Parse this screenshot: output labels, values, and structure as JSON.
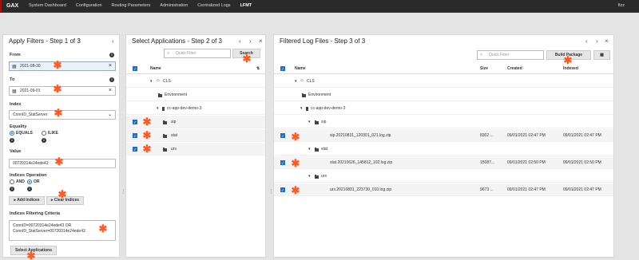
{
  "topbar": {
    "brand": "GAX",
    "nav": [
      "System Dashboard",
      "Configuration",
      "Routing Parameters",
      "Administration",
      "Centralized Logs",
      "LFMT"
    ],
    "active": "LFMT",
    "user": "fizz"
  },
  "filters": {
    "title": "Apply Filters - Step 1 of 3",
    "from_label": "From",
    "from_value": "2021-08-30",
    "to_label": "To",
    "to_value": "2021-09-01",
    "index_label": "Index",
    "index_value": "ConnID_StatServer",
    "equality_label": "Equality",
    "equality_options": [
      "EQUALS",
      "ILIKE"
    ],
    "value_label": "Value",
    "value_value": "00720314e24ede43",
    "indices_op_label": "Indices Operation",
    "indices_op_options": [
      "AND",
      "OR"
    ],
    "add_indices": "Add Indices",
    "clear_indices": "Clear Indices",
    "criteria_label": "Indices Filtering Criteria",
    "criteria_line1": "ConnID=00720314e24ede43 OR",
    "criteria_line2": "ConnID_StatServer=00720314e24ede43",
    "select_apps": "Select Applications"
  },
  "apps": {
    "title": "Select Applications - Step 2 of 3",
    "filter_placeholder": "Quick Filter",
    "search": "Search",
    "col_name": "Name",
    "rows": [
      "CLS",
      "Environment",
      "cc-app-dev-demo-3",
      "sip",
      "stat",
      "urs"
    ]
  },
  "logs": {
    "title": "Filtered Log Files - Step 3 of 3",
    "filter_placeholder": "Quick Filter",
    "build": "Build Package",
    "cols": [
      "Name",
      "Size",
      "Created",
      "Indexed"
    ],
    "tree": [
      "CLS",
      "Environment",
      "cc-app-dev-demo-3",
      "sip",
      "stat",
      "urs"
    ],
    "files": [
      {
        "name": "sip.20210831_120301_021.log.zip",
        "size": "8302 ...",
        "created": "09/01/2021 02:47 PM",
        "indexed": "09/01/2021 02:47 PM"
      },
      {
        "name": "stat.20210626_145812_102.log.zip",
        "size": "15087...",
        "created": "09/01/2021 02:50 PM",
        "indexed": "09/01/2021 02:50 PM"
      },
      {
        "name": "urs.20210831_223730_010.log.zip",
        "size": "9673 ...",
        "created": "09/01/2021 02:47 PM",
        "indexed": "09/01/2021 02:47 PM"
      }
    ]
  },
  "colors": {
    "accent": "#1f6fc9",
    "marker": "#ff5a1f",
    "topbar": "#2a2a2a"
  }
}
